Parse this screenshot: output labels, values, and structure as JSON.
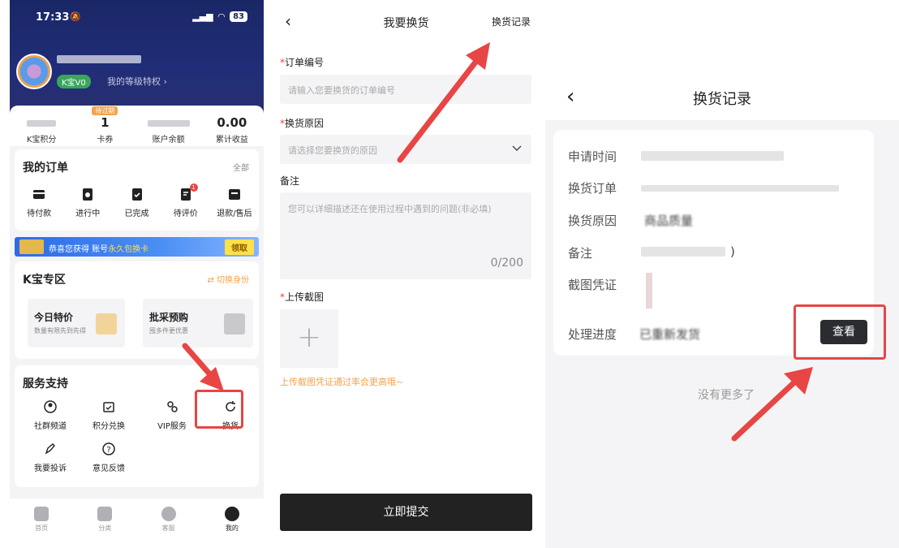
{
  "panel_profile": {
    "status_time": "17:33",
    "battery": "83",
    "user_badge": "K宝V0",
    "perk_link": "我的等级特权 ›",
    "stats": [
      {
        "value": "",
        "label": "K宝积分"
      },
      {
        "value": "1",
        "label": "卡券",
        "tag": "待过期"
      },
      {
        "value": "",
        "label": "账户余额"
      },
      {
        "value": "0.00",
        "label": "累计收益"
      }
    ],
    "orders": {
      "title": "我的订单",
      "more": "全部",
      "items": [
        "待付款",
        "进行中",
        "已完成",
        "待评价",
        "退款/售后"
      ],
      "review_badge": "1"
    },
    "banner": {
      "text_a": "恭喜您获得 账号",
      "text_b": "永久包换卡",
      "button": "领取"
    },
    "kzone": {
      "title": "K宝专区",
      "switch": "⇄ 切换身份",
      "tiles": [
        {
          "title": "今日特价",
          "sub": "数量有限先到先得"
        },
        {
          "title": "批采预购",
          "sub": "囤多件更优惠"
        }
      ]
    },
    "service": {
      "title": "服务支持",
      "items": [
        "社群频道",
        "积分兑换",
        "VIP服务",
        "换货",
        "我要投诉",
        "意见反馈"
      ]
    },
    "tabbar": [
      "首页",
      "分类",
      "客服",
      "我的"
    ]
  },
  "panel_form": {
    "title": "我要换货",
    "record_link": "换货记录",
    "order_label": "订单编号",
    "order_placeholder": "请输入您要换货的订单编号",
    "reason_label": "换货原因",
    "reason_placeholder": "请选择您要换货的原因",
    "note_label": "备注",
    "note_placeholder": "您可以详细描述还在使用过程中遇到的问题(非必填)",
    "note_counter": "0/200",
    "upload_label": "上传截图",
    "upload_plus": "+",
    "upload_hint": "上传截图凭证通过率会更高哦~",
    "submit": "立即提交",
    "required_mark": "*"
  },
  "panel_record": {
    "title": "换货记录",
    "rows": {
      "apply_time": "申请时间",
      "order": "换货订单",
      "reason": "换货原因",
      "reason_value": "商品质量",
      "note": "备注",
      "note_value": ")",
      "screenshot": "截图凭证",
      "progress": "处理进度",
      "progress_value": "已重新发货"
    },
    "view_button": "查看",
    "no_more": "没有更多了"
  }
}
